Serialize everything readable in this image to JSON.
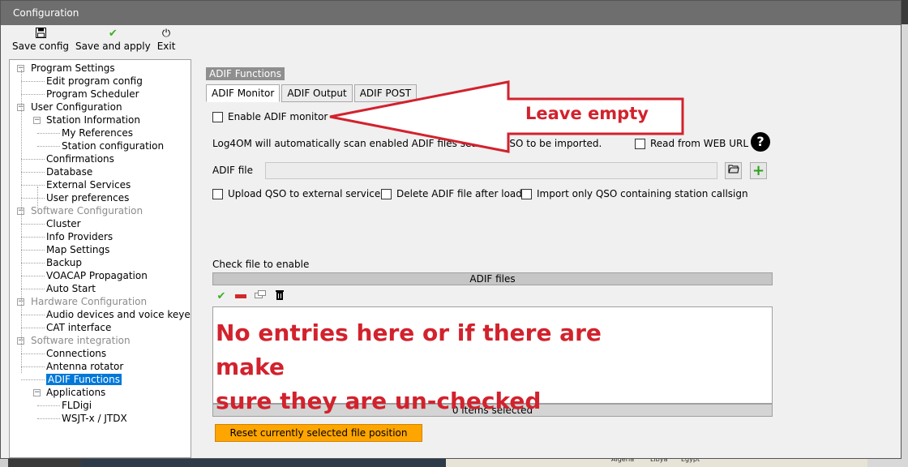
{
  "window": {
    "title": "Configuration"
  },
  "toolbar": {
    "save_config": "Save config",
    "save_apply": "Save and apply",
    "exit": "Exit"
  },
  "tree": [
    {
      "label": "Program Settings",
      "level": 0,
      "expander": "−",
      "grey": false
    },
    {
      "label": "Edit program config",
      "level": 1,
      "grey": false
    },
    {
      "label": "Program Scheduler",
      "level": 1,
      "grey": false
    },
    {
      "label": "User Configuration",
      "level": 0,
      "expander": "−",
      "grey": false
    },
    {
      "label": "Station Information",
      "level": 1,
      "expander": "−",
      "grey": false
    },
    {
      "label": "My References",
      "level": 2,
      "grey": false
    },
    {
      "label": "Station configuration",
      "level": 2,
      "grey": false
    },
    {
      "label": "Confirmations",
      "level": 1,
      "grey": false
    },
    {
      "label": "Database",
      "level": 1,
      "grey": false
    },
    {
      "label": "External Services",
      "level": 1,
      "grey": false
    },
    {
      "label": "User preferences",
      "level": 1,
      "grey": false
    },
    {
      "label": "Software Configuration",
      "level": 0,
      "expander": "−",
      "grey": true
    },
    {
      "label": "Cluster",
      "level": 1,
      "grey": false
    },
    {
      "label": "Info Providers",
      "level": 1,
      "grey": false
    },
    {
      "label": "Map Settings",
      "level": 1,
      "grey": false
    },
    {
      "label": "Backup",
      "level": 1,
      "grey": false
    },
    {
      "label": "VOACAP Propagation",
      "level": 1,
      "grey": false
    },
    {
      "label": "Auto Start",
      "level": 1,
      "grey": false
    },
    {
      "label": "Hardware Configuration",
      "level": 0,
      "expander": "−",
      "grey": true
    },
    {
      "label": "Audio devices and voice keyer",
      "level": 1,
      "grey": false
    },
    {
      "label": "CAT interface",
      "level": 1,
      "grey": false
    },
    {
      "label": "Software integration",
      "level": 0,
      "expander": "−",
      "grey": true
    },
    {
      "label": "Connections",
      "level": 1,
      "grey": false
    },
    {
      "label": "Antenna rotator",
      "level": 1,
      "grey": false
    },
    {
      "label": "ADIF Functions",
      "level": 1,
      "grey": false,
      "selected": true
    },
    {
      "label": "Applications",
      "level": 1,
      "expander": "−",
      "grey": false
    },
    {
      "label": "FLDigi",
      "level": 2,
      "grey": false
    },
    {
      "label": "WSJT-x / JTDX",
      "level": 2,
      "grey": false
    }
  ],
  "panel": {
    "group_title": "ADIF Functions",
    "tabs": [
      "ADIF Monitor",
      "ADIF Output",
      "ADIF POST"
    ],
    "active_tab": 0,
    "enable_monitor": {
      "label": "Enable ADIF monitor",
      "checked": false
    },
    "info_text": "Log4OM will automatically scan enabled ADIF files searching",
    "info_text_tail": "v QSO to be imported.",
    "read_web": {
      "label": "Read from WEB URL",
      "checked": false
    },
    "adif_file_label": "ADIF file",
    "adif_file_value": "",
    "upload_qso": {
      "label": "Upload QSO to external services",
      "checked": false
    },
    "delete_file": {
      "label": "Delete ADIF file after load",
      "checked": false
    },
    "import_only": {
      "label": "Import only QSO containing station callsign",
      "checked": false
    },
    "check_file_label": "Check file to enable",
    "list_header": "ADIF files",
    "list_footer": "0 items selected",
    "reset_button": "Reset currently selected file position"
  },
  "annotations": {
    "arrow_label": "Leave empty",
    "list_note_line1": "No entries here or if there are make",
    "list_note_line2": "sure they are un-checked",
    "color": "#d2222d"
  },
  "background_map_labels": [
    "Algeria",
    "Libya",
    "Egypt"
  ]
}
